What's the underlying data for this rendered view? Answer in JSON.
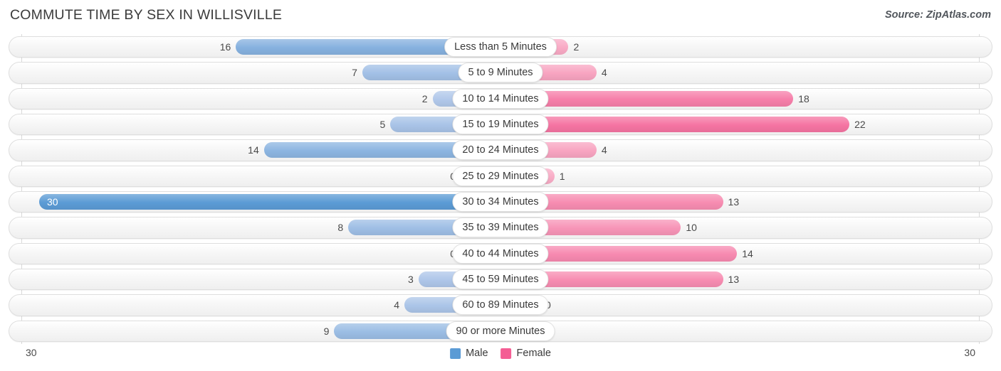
{
  "header": {
    "title": "COMMUTE TIME BY SEX IN WILLISVILLE",
    "source": "Source: ZipAtlas.com"
  },
  "axis": {
    "min_label": "30",
    "max_label": "30"
  },
  "legend": {
    "items": [
      {
        "label": "Male",
        "color": "#5B9BD5"
      },
      {
        "label": "Female",
        "color": "#F45E94"
      }
    ]
  },
  "colors": {
    "male_dark": "#5B9BD5",
    "male_light": "#B7CBEB",
    "female_dark": "#F45E94",
    "female_light": "#F9AFC8",
    "track": "#f2f2f2",
    "track_border": "#dedede",
    "gridline": "#d9d9d9"
  },
  "chart_data": {
    "type": "bar",
    "orientation": "horizontal",
    "style": "diverging-bidirectional",
    "title": "COMMUTE TIME BY SEX IN WILLISVILLE",
    "xlabel": "",
    "ylabel": "",
    "axis_max": 30,
    "xlim": [
      30,
      30
    ],
    "grid": true,
    "legend_position": "bottom-center",
    "categories": [
      "Less than 5 Minutes",
      "5 to 9 Minutes",
      "10 to 14 Minutes",
      "15 to 19 Minutes",
      "20 to 24 Minutes",
      "25 to 29 Minutes",
      "30 to 34 Minutes",
      "35 to 39 Minutes",
      "40 to 44 Minutes",
      "45 to 59 Minutes",
      "60 to 89 Minutes",
      "90 or more Minutes"
    ],
    "series": [
      {
        "name": "Male",
        "side": "left",
        "color": "#5B9BD5",
        "values": [
          16,
          7,
          2,
          5,
          14,
          0,
          30,
          8,
          0,
          3,
          4,
          9
        ]
      },
      {
        "name": "Female",
        "side": "right",
        "color": "#F45E94",
        "values": [
          2,
          4,
          18,
          22,
          4,
          1,
          13,
          10,
          14,
          13,
          0,
          0
        ]
      }
    ]
  }
}
